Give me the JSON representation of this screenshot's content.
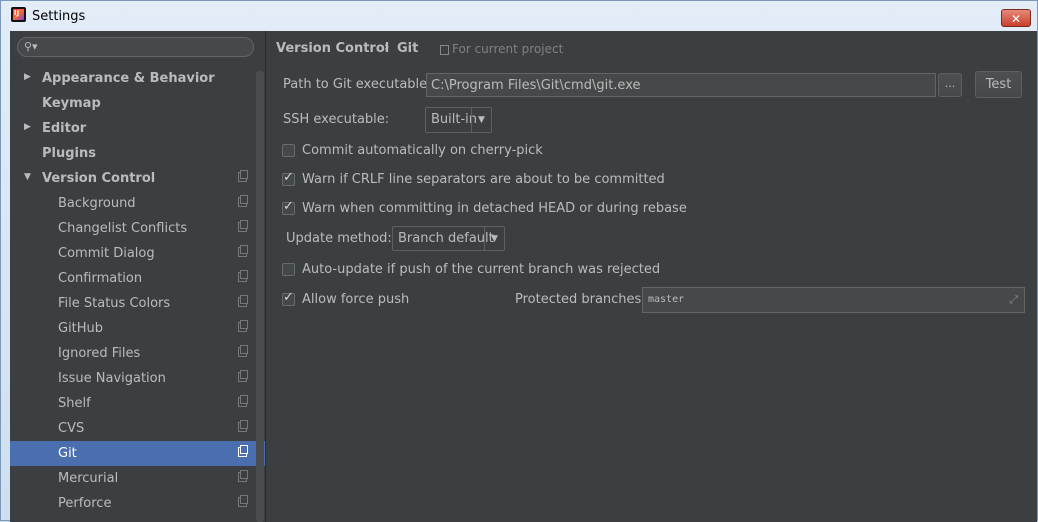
{
  "window": {
    "title": "Settings",
    "close_label": "✕"
  },
  "search": {
    "placeholder": ""
  },
  "sidebar": {
    "items": [
      {
        "label": "Appearance & Behavior",
        "arrow": "▶"
      },
      {
        "label": "Keymap"
      },
      {
        "label": "Editor",
        "arrow": "▶"
      },
      {
        "label": "Plugins"
      },
      {
        "label": "Version Control",
        "arrow": "▼"
      },
      {
        "label": "Background"
      },
      {
        "label": "Changelist Conflicts"
      },
      {
        "label": "Commit Dialog"
      },
      {
        "label": "Confirmation"
      },
      {
        "label": "File Status Colors"
      },
      {
        "label": "GitHub"
      },
      {
        "label": "Ignored Files"
      },
      {
        "label": "Issue Navigation"
      },
      {
        "label": "Shelf"
      },
      {
        "label": "CVS"
      },
      {
        "label": "Git"
      },
      {
        "label": "Mercurial"
      },
      {
        "label": "Perforce"
      }
    ]
  },
  "breadcrumb": {
    "parent": "Version Control",
    "separator": "›",
    "current": "Git",
    "scope": "For current project"
  },
  "git": {
    "path_label": "Path to Git executable:",
    "path_value": "C:\\Program Files\\Git\\cmd\\git.exe",
    "browse_label": "...",
    "test_label": "Test",
    "ssh_label": "SSH executable:",
    "ssh_value": "Built-in",
    "cherry_pick_label": "Commit automatically on cherry-pick",
    "crlf_label": "Warn if CRLF line separators are about to be committed",
    "detached_label": "Warn when committing in detached HEAD or during rebase",
    "update_method_label": "Update method:",
    "update_method_value": "Branch default",
    "auto_update_label": "Auto-update if push of the current branch was rejected",
    "force_push_label": "Allow force push",
    "protected_label": "Protected branches:",
    "protected_value": "master",
    "checkmark": "✓",
    "dropdown_arrow": "▼",
    "expand_icon": "⤢"
  },
  "colors": {
    "selection": "#4b6eaf",
    "background": "#3c3f41"
  }
}
